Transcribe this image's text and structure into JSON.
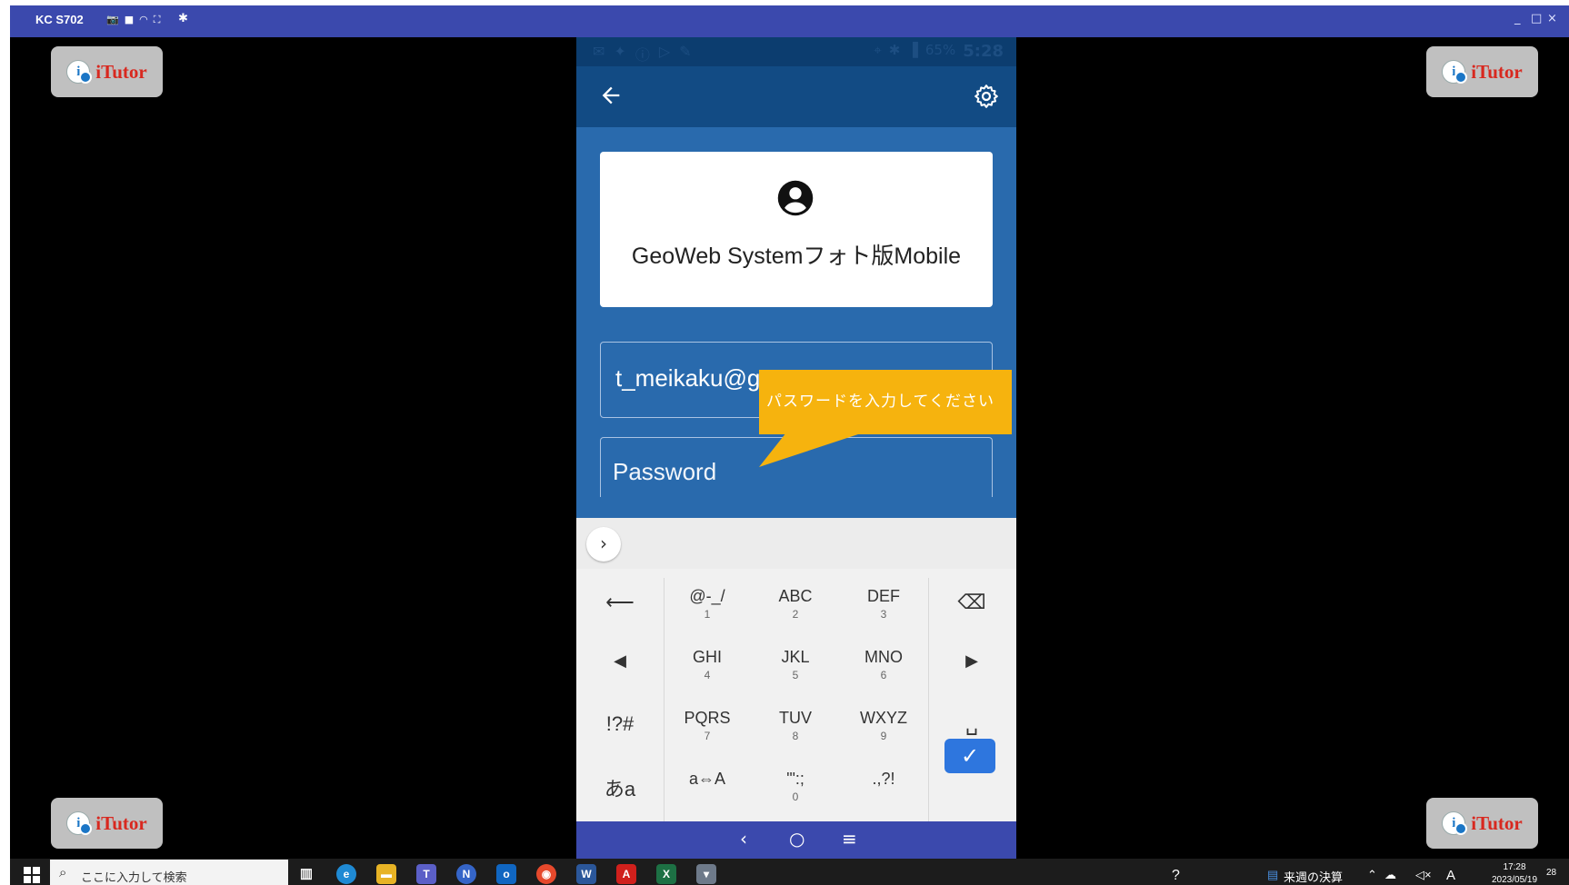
{
  "window": {
    "title": "KC S702",
    "controls": [
      "_",
      "□",
      "×"
    ]
  },
  "watermark": {
    "text": "iTutor"
  },
  "phone": {
    "status": {
      "battery": "65%",
      "time": "5:28"
    },
    "app": {
      "name": "GeoWeb Systemフォト版Mobile",
      "email_value": "t_meikaku@g",
      "password_placeholder": "Password"
    },
    "callout_text": "パスワードを入力してください",
    "keyboard": {
      "rows": [
        [
          {
            "m": "@-_/",
            "s": "1"
          },
          {
            "m": "ABC",
            "s": "2"
          },
          {
            "m": "DEF",
            "s": "3"
          }
        ],
        [
          {
            "m": "GHI",
            "s": "4"
          },
          {
            "m": "JKL",
            "s": "5"
          },
          {
            "m": "MNO",
            "s": "6"
          }
        ],
        [
          {
            "m": "PQRS",
            "s": "7"
          },
          {
            "m": "TUV",
            "s": "8"
          },
          {
            "m": "WXYZ",
            "s": "9"
          }
        ],
        [
          {
            "m": "a⇔A",
            "s": ""
          },
          {
            "m": "'\":;",
            "s": "0"
          },
          {
            "m": ".,?!",
            "s": ""
          }
        ]
      ],
      "left_keys": [
        "⟵",
        "◀",
        "!?#",
        "あa"
      ],
      "right_keys": [
        "⌫",
        "▶",
        "␣",
        "✓"
      ]
    },
    "nav": {
      "back": "‹",
      "home": "○",
      "menu": "≡"
    }
  },
  "taskbar": {
    "search_placeholder": "ここに入力して検索",
    "pinned_file": "来週の決算",
    "clock_time": "17:28",
    "clock_date": "2023/05/19",
    "notification_count": "28",
    "ime": "A"
  },
  "colors": {
    "title_bar": "#3b49ad",
    "app_bar": "#124b84",
    "app_bg": "#296aad",
    "callout": "#f6b30e",
    "enter_key": "#2e76de",
    "watermark_text": "#d8281f"
  }
}
